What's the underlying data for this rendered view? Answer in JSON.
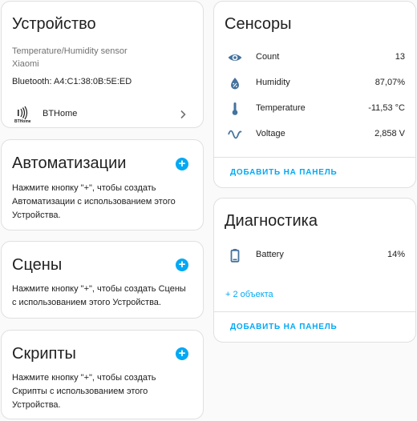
{
  "device": {
    "title": "Устройство",
    "model": "Temperature/Humidity sensor",
    "manufacturer": "Xiaomi",
    "connection": "Bluetooth: A4:C1:38:0B:5E:ED",
    "integration": "BTHome",
    "integration_logo_text": "BTHome"
  },
  "automations": {
    "title": "Автоматизации",
    "description": "Нажмите кнопку \"+\", чтобы создать Автоматизации с использованием этого Устройства."
  },
  "scenes": {
    "title": "Сцены",
    "description": "Нажмите кнопку \"+\", чтобы создать Сцены с использованием этого Устройства."
  },
  "scripts": {
    "title": "Скрипты",
    "description": "Нажмите кнопку \"+\", чтобы создать Скрипты с использованием этого Устройства."
  },
  "sensors": {
    "title": "Сенсоры",
    "items": [
      {
        "name": "Count",
        "value": "13",
        "icon": "eye-icon"
      },
      {
        "name": "Humidity",
        "value": "87,07%",
        "icon": "water-percent-icon"
      },
      {
        "name": "Temperature",
        "value": "-11,53 °C",
        "icon": "thermometer-icon"
      },
      {
        "name": "Voltage",
        "value": "2,858 V",
        "icon": "sine-wave-icon"
      }
    ],
    "add_label": "ДОБАВИТЬ НА ПАНЕЛЬ"
  },
  "diagnostics": {
    "title": "Диагностика",
    "items": [
      {
        "name": "Battery",
        "value": "14%",
        "icon": "battery-icon"
      }
    ],
    "more_label": "+ 2 объекта",
    "add_label": "ДОБАВИТЬ НА ПАНЕЛЬ"
  },
  "colors": {
    "accent": "#03a9f4",
    "icon": "#44739e",
    "text": "#212121",
    "muted": "#727272",
    "border": "#e0e0e0"
  }
}
